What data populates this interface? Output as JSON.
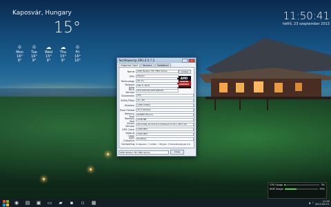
{
  "weather": {
    "location": "Kaposvár, Hungary",
    "temperature": "15°",
    "days": [
      {
        "icon": "sun-icon",
        "label": "Mon",
        "hi": "16°",
        "lo": "9°"
      },
      {
        "icon": "sun-icon",
        "label": "Tue",
        "hi": "16°",
        "lo": "9°"
      },
      {
        "icon": "cloud-icon",
        "label": "Wed",
        "hi": "15°",
        "lo": "9°"
      },
      {
        "icon": "cloud-icon",
        "label": "Thu",
        "hi": "15°",
        "lo": "9°"
      },
      {
        "icon": "sun-icon",
        "label": "Fri",
        "hi": "16°",
        "lo": "10°"
      }
    ]
  },
  "clock": {
    "time": "11:50:41",
    "date": "hétfő, 23 szeptember 2013"
  },
  "gpuz": {
    "title": "TechPowerUp GPU-Z 0.7.3",
    "tabs": [
      "Graphics Card",
      "Sensors",
      "Validation"
    ],
    "lookup": "Lookup",
    "logo_top": "AMD",
    "logo_bottom": "RADEON GRAPHICS",
    "rows": [
      {
        "label": "Name",
        "value": "AMD Radeon HD 7800 Series"
      },
      {
        "label": "GPU",
        "value": "Pitcairn"
      },
      {
        "label": "Technology",
        "value": "28 nm"
      },
      {
        "label": "Release Date",
        "value": "Mar 5, 2012"
      },
      {
        "label": "BIOS Version",
        "value": "015.018.000.000.000034"
      },
      {
        "label": "Subvendor",
        "value": "XFX"
      },
      {
        "label": "ROPs/TMUs",
        "value": "32 / 80"
      },
      {
        "label": "Shaders",
        "value": "1280 Unified"
      },
      {
        "label": "Pixel Fillrate",
        "value": "32.0 GPixel/s"
      },
      {
        "label": "Memory Type",
        "value": "GDDR5 (Hynix)"
      },
      {
        "label": "Memory Size",
        "value": "2048 MB"
      },
      {
        "label": "Driver Version",
        "value": "atiumdag 12.104.0.0 (Catalyst 13.10) / Win7 64"
      },
      {
        "label": "GPU Clock",
        "value": "1000 MHz"
      },
      {
        "label": "Default Clock",
        "value": "1000 MHz"
      },
      {
        "label": "AMD CrossFire",
        "value": "Disabled"
      },
      {
        "label": "Computing",
        "value": ""
      }
    ],
    "computing": [
      "OpenCL",
      "CUDA",
      "PhysX",
      "DirectCompute 5.0"
    ],
    "select_value": "AMD Radeon HD 7800 Series",
    "close": "Close"
  },
  "gadget": {
    "rows": [
      {
        "label": "CPU Usage",
        "value": "3%",
        "fill": 0.03
      },
      {
        "label": "RAM Usage",
        "value": "35%",
        "fill": 0.35
      }
    ]
  },
  "taskbar": {
    "time": "11:50",
    "date": "2013.09.23."
  }
}
